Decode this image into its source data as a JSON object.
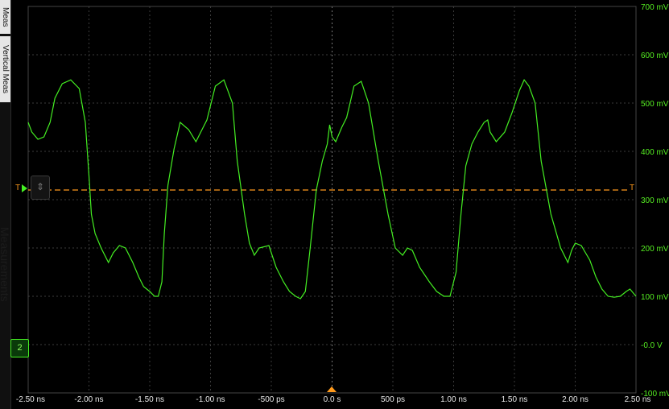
{
  "sidebar": {
    "tab_measure": "Meas",
    "tab_vertical": "Vertical Meas",
    "ghost_text": "Measurements"
  },
  "trigger": {
    "left_label": "T",
    "right_label": "T",
    "level_mv": 320,
    "color": "#ff9a1c"
  },
  "channel": {
    "marker_label": "2",
    "color": "#44ee22"
  },
  "colors": {
    "trace": "#44ee22",
    "grid": "#3c3c3c",
    "ylabels": "#55ee22",
    "xlabels": "#e8e8e8",
    "background": "#000000"
  },
  "chart_data": {
    "type": "line",
    "x_unit": "ns",
    "y_unit": "mV",
    "xlim": [
      -2.5,
      2.5
    ],
    "ylim": [
      -100,
      700
    ],
    "x_tick_labels": [
      "-2.50 ns",
      "-2.00 ns",
      "-1.50 ns",
      "-1.00 ns",
      "-500 ps",
      "0.0 s",
      "500 ps",
      "1.00 ns",
      "1.50 ns",
      "2.00 ns",
      "2.50 ns"
    ],
    "y_tick_labels": [
      "700 mV",
      "600 mV",
      "500 mV",
      "400 mV",
      "300 mV",
      "200 mV",
      "100 mV",
      "-0.0 V",
      "-100 mV"
    ],
    "grid": true,
    "series": [
      {
        "x": [
          -2.5,
          -2.47,
          -2.42,
          -2.37,
          -2.32,
          -2.28,
          -2.22,
          -2.15,
          -2.08,
          -2.03,
          -2.0,
          -1.98,
          -1.95,
          -1.9,
          -1.84,
          -1.8,
          -1.75,
          -1.7,
          -1.64,
          -1.59,
          -1.55,
          -1.5,
          -1.46,
          -1.43,
          -1.4,
          -1.38,
          -1.35,
          -1.3,
          -1.25,
          -1.18,
          -1.12,
          -1.08,
          -1.03,
          -0.96,
          -0.89,
          -0.82,
          -0.78,
          -0.72,
          -0.68,
          -0.64,
          -0.6,
          -0.52,
          -0.46,
          -0.4,
          -0.35,
          -0.3,
          -0.26,
          -0.22,
          -0.18,
          -0.13,
          -0.08,
          -0.04,
          -0.02,
          0.0,
          0.03,
          0.08,
          0.12,
          0.18,
          0.24,
          0.3,
          0.38,
          0.46,
          0.52,
          0.58,
          0.62,
          0.66,
          0.72,
          0.8,
          0.86,
          0.92,
          0.97,
          1.02,
          1.06,
          1.1,
          1.15,
          1.2,
          1.25,
          1.28,
          1.3,
          1.35,
          1.42,
          1.48,
          1.54,
          1.58,
          1.62,
          1.67,
          1.72,
          1.8,
          1.88,
          1.94,
          1.97,
          2.0,
          2.05,
          2.12,
          2.17,
          2.22,
          2.27,
          2.32,
          2.37,
          2.42,
          2.45,
          2.5
        ],
        "y": [
          460,
          440,
          425,
          430,
          460,
          510,
          540,
          548,
          530,
          460,
          350,
          270,
          230,
          200,
          170,
          190,
          205,
          200,
          170,
          140,
          120,
          110,
          100,
          100,
          130,
          230,
          330,
          405,
          460,
          445,
          420,
          440,
          465,
          535,
          548,
          500,
          380,
          270,
          210,
          185,
          200,
          205,
          160,
          130,
          110,
          100,
          95,
          110,
          200,
          320,
          380,
          415,
          455,
          430,
          420,
          450,
          470,
          535,
          545,
          500,
          380,
          270,
          200,
          185,
          200,
          195,
          160,
          130,
          110,
          100,
          100,
          150,
          270,
          370,
          415,
          440,
          460,
          465,
          440,
          420,
          440,
          480,
          525,
          548,
          535,
          500,
          380,
          270,
          200,
          170,
          195,
          210,
          205,
          175,
          140,
          115,
          100,
          98,
          100,
          110,
          115,
          100
        ]
      }
    ]
  }
}
